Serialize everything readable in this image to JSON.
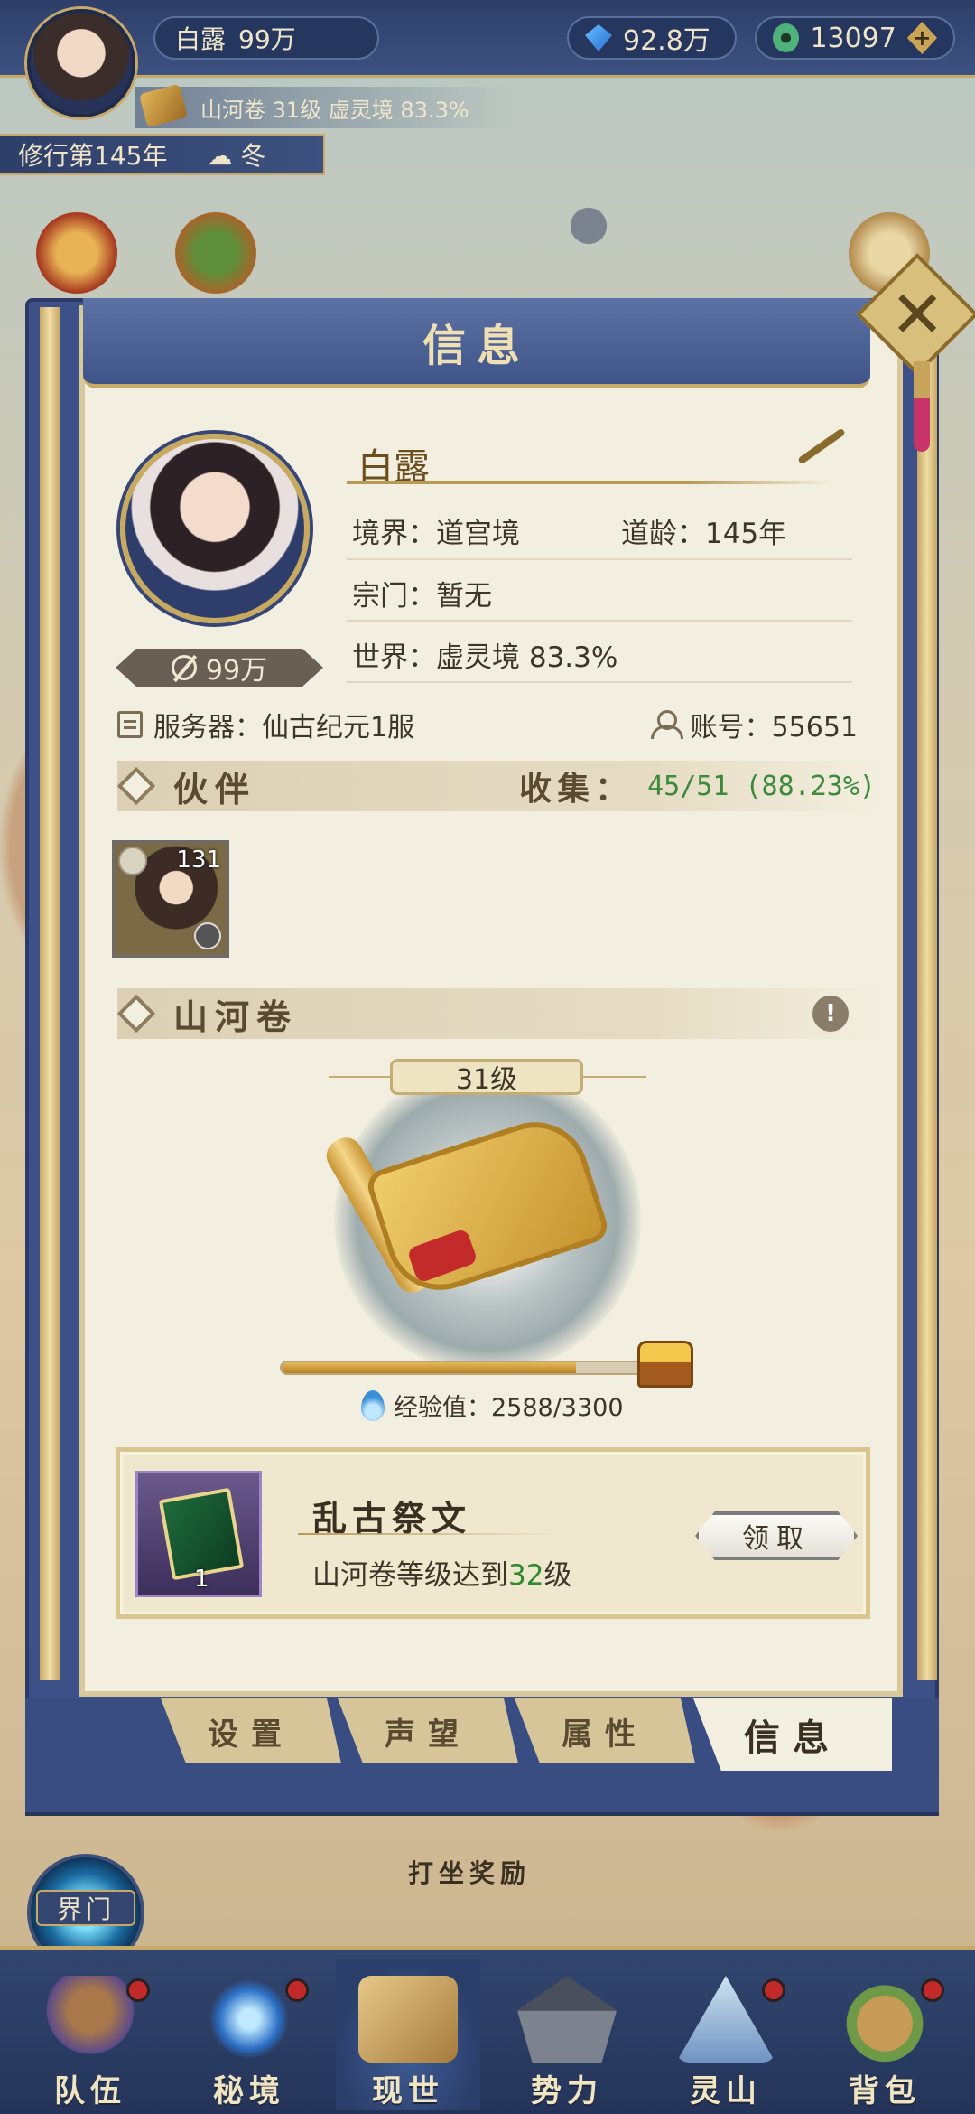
{
  "topbar": {
    "player_name": "白露",
    "power": "99万",
    "gems": "92.8万",
    "jade": "13097",
    "sub_info": "山河卷 31级 虚灵境 83.3%",
    "year": "修行第145年",
    "season": "冬"
  },
  "panel": {
    "title": "信息",
    "close_label": "✕",
    "profile": {
      "name": "白露",
      "power_badge": "99万",
      "realm_label": "境界：道宫境",
      "age_label": "道龄：145年",
      "sect_label": "宗门：暂无",
      "world_label": "世界：虚灵境  83.3%"
    },
    "server_label": "服务器：仙古纪元1服",
    "account_label": "账号：55651",
    "partners": {
      "title": "伙伴",
      "collect_label": "收集：",
      "collect_value": "45/51 (88.23%)",
      "items": [
        {
          "level": "131"
        }
      ]
    },
    "scroll": {
      "title": "山河卷",
      "warn": "!",
      "level": "31级",
      "exp_label": "经验值：2588/3300",
      "exp_progress": 0.784
    },
    "reward": {
      "title": "乱古祭文",
      "desc_prefix": "山河卷等级达到",
      "desc_level": "32",
      "desc_suffix": "级",
      "count": "1",
      "claim_label": "领取"
    },
    "tabs": [
      {
        "label": "设置"
      },
      {
        "label": "声望"
      },
      {
        "label": "属性"
      },
      {
        "label": "信息"
      }
    ]
  },
  "world": {
    "gate_label": "界门",
    "meditate_label": "打坐奖励"
  },
  "bottom_nav": [
    {
      "label": "队伍",
      "dot": true
    },
    {
      "label": "秘境",
      "dot": true
    },
    {
      "label": "现世",
      "dot": false
    },
    {
      "label": "势力",
      "dot": false
    },
    {
      "label": "灵山",
      "dot": true
    },
    {
      "label": "背包",
      "dot": true
    }
  ],
  "colors": {
    "accent_gold": "#c7a968",
    "panel_blue": "#3d5087",
    "paper": "#f3efe0",
    "highlight_green": "#3c8a3c",
    "notification_red": "#c22a2a"
  }
}
